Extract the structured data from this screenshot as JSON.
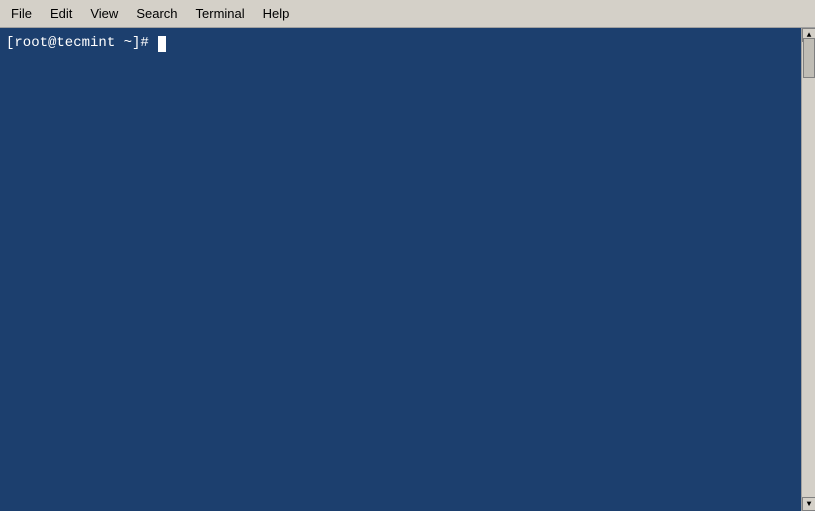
{
  "menubar": {
    "items": [
      {
        "id": "file",
        "label": "File"
      },
      {
        "id": "edit",
        "label": "Edit"
      },
      {
        "id": "view",
        "label": "View"
      },
      {
        "id": "search",
        "label": "Search"
      },
      {
        "id": "terminal",
        "label": "Terminal"
      },
      {
        "id": "help",
        "label": "Help"
      }
    ]
  },
  "terminal": {
    "prompt": "[root@tecmint ~]# ",
    "background_color": "#1c3f6e"
  }
}
